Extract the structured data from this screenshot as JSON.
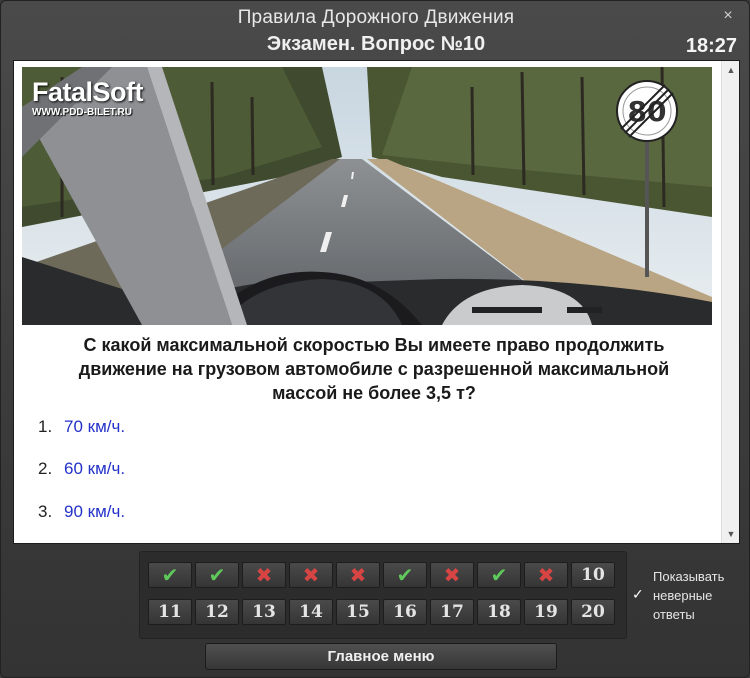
{
  "window": {
    "title": "Правила Дорожного Движения",
    "subtitle": "Экзамен. Вопрос №10",
    "timer": "18:27",
    "close_icon": "×"
  },
  "image": {
    "logo_name": "FatalSoft",
    "logo_site": "WWW.PDD-BILET.RU",
    "sign_text": "80"
  },
  "question": {
    "text": "С какой максимальной скоростью Вы имеете право продолжить движение на грузовом автомобиле с разрешенной максимальной массой не более 3,5 т?",
    "lines": [
      "С какой максимальной скоростью Вы имеете право продолжить",
      "движение на грузовом автомобиле с разрешенной максимальной",
      "массой не более 3,5 т?"
    ]
  },
  "answers": [
    {
      "num": "1.",
      "text": "70 км/ч."
    },
    {
      "num": "2.",
      "text": "60 км/ч."
    },
    {
      "num": "3.",
      "text": "90 км/ч."
    }
  ],
  "questions_nav": [
    {
      "label": "",
      "status": "correct",
      "icon": "check-icon"
    },
    {
      "label": "",
      "status": "correct",
      "icon": "check-icon"
    },
    {
      "label": "",
      "status": "wrong",
      "icon": "cross-icon"
    },
    {
      "label": "",
      "status": "wrong",
      "icon": "cross-icon"
    },
    {
      "label": "",
      "status": "wrong",
      "icon": "cross-icon"
    },
    {
      "label": "",
      "status": "correct",
      "icon": "check-icon"
    },
    {
      "label": "",
      "status": "wrong",
      "icon": "cross-icon"
    },
    {
      "label": "",
      "status": "correct",
      "icon": "check-icon"
    },
    {
      "label": "",
      "status": "wrong",
      "icon": "cross-icon"
    },
    {
      "label": "10",
      "status": "current",
      "icon": ""
    },
    {
      "label": "11",
      "status": "pending",
      "icon": ""
    },
    {
      "label": "12",
      "status": "pending",
      "icon": ""
    },
    {
      "label": "13",
      "status": "pending",
      "icon": ""
    },
    {
      "label": "14",
      "status": "pending",
      "icon": ""
    },
    {
      "label": "15",
      "status": "pending",
      "icon": ""
    },
    {
      "label": "16",
      "status": "pending",
      "icon": ""
    },
    {
      "label": "17",
      "status": "pending",
      "icon": ""
    },
    {
      "label": "18",
      "status": "pending",
      "icon": ""
    },
    {
      "label": "19",
      "status": "pending",
      "icon": ""
    },
    {
      "label": "20",
      "status": "pending",
      "icon": ""
    }
  ],
  "show_wrong": {
    "label_lines": [
      "Показывать",
      "неверные",
      "ответы"
    ],
    "checked": true
  },
  "main_menu_label": "Главное меню",
  "colors": {
    "answer_text": "#2432c9",
    "correct": "#5ec95a",
    "wrong": "#d64444"
  }
}
